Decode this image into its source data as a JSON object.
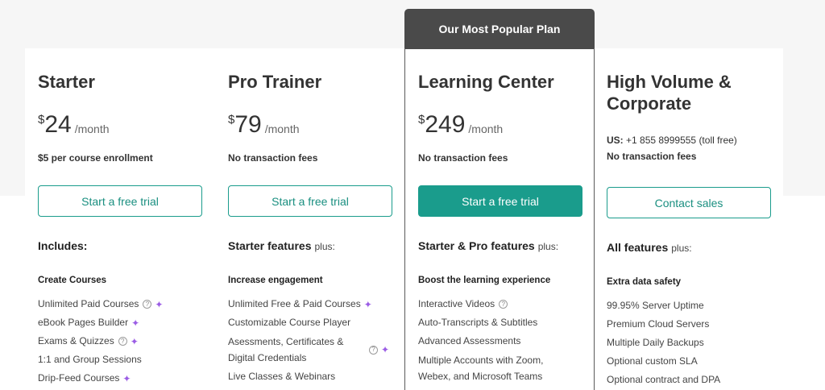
{
  "popular_label": "Our Most Popular Plan",
  "plans": [
    {
      "name": "Starter",
      "currency": "$",
      "amount": "24",
      "period": "/month",
      "fee": "$5 per course enrollment",
      "button": "Start a free trial",
      "features_heading": "Includes:",
      "features_plus": "",
      "group_title": "Create Courses",
      "items": [
        "Unlimited Paid Courses",
        "eBook Pages Builder",
        "Exams & Quizzes",
        "1:1 and Group Sessions",
        "Drip-Feed Courses"
      ]
    },
    {
      "name": "Pro Trainer",
      "currency": "$",
      "amount": "79",
      "period": "/month",
      "fee": "No transaction fees",
      "button": "Start a free trial",
      "features_heading": "Starter features",
      "features_plus": "plus:",
      "group_title": "Increase engagement",
      "items": [
        "Unlimited Free & Paid Courses",
        "Customizable Course Player",
        "Asessments, Certificates & Digital Credentials",
        "Live Classes & Webinars"
      ]
    },
    {
      "name": "Learning Center",
      "currency": "$",
      "amount": "249",
      "period": "/month",
      "fee": "No transaction fees",
      "button": "Start a free trial",
      "features_heading": "Starter & Pro features",
      "features_plus": "plus:",
      "group_title": "Boost the learning experience",
      "items": [
        "Interactive Videos",
        "Auto-Transcripts & Subtitles",
        "Advanced Assessments",
        "Multiple Accounts with Zoom, Webex, and Microsoft Teams"
      ]
    },
    {
      "name": "High Volume & Corporate",
      "phone_label": "US:",
      "phone_text": "+1 855 8999555 (toll free)",
      "fee": "No transaction fees",
      "button": "Contact sales",
      "features_heading": "All features",
      "features_plus": "plus:",
      "group_title": "Extra data safety",
      "items": [
        "99.95% Server Uptime",
        "Premium Cloud Servers",
        "Multiple Daily Backups",
        "Optional custom SLA",
        "Optional contract and DPA"
      ]
    }
  ],
  "icons": {
    "help": "question-circle-icon",
    "ai": "sparkle-icon",
    "help_glyph": "?",
    "ai_glyph": "✦"
  },
  "colors": {
    "accent": "#1a9c8c",
    "popular_tab": "#4a4a4a",
    "sparkle": "#9b5de5"
  }
}
